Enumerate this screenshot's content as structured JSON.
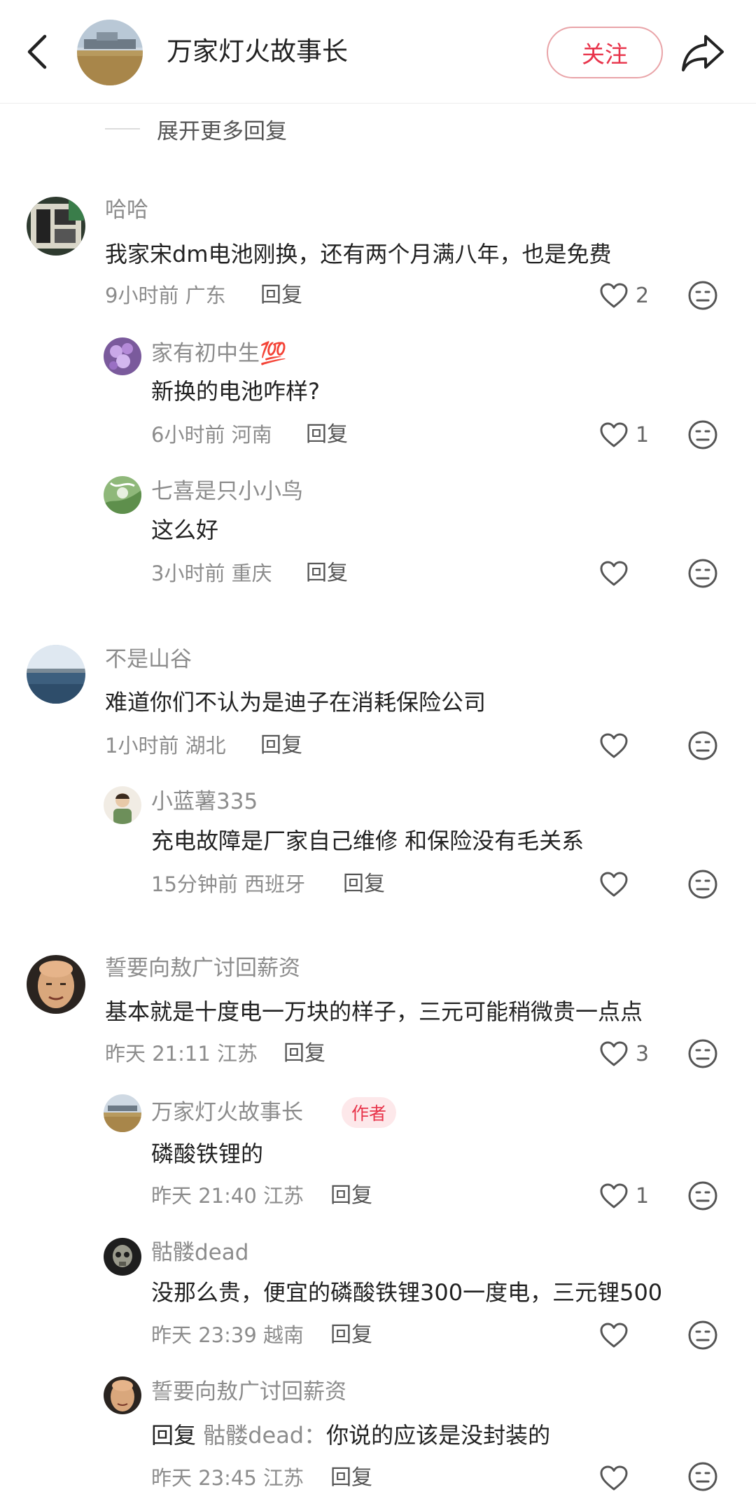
{
  "header": {
    "title": "万家灯火故事长",
    "follow_label": "关注"
  },
  "expand_label": "展开更多回复",
  "reply_label": "回复",
  "author_badge": "作者",
  "comments": [
    {
      "name": "哈哈",
      "text": "我家宋dm电池刚换，还有两个月满八年，也是免费",
      "meta": "9小时前 广东",
      "likes": "2"
    },
    {
      "name": "家有初中生💯",
      "text": "新换的电池咋样?",
      "meta": "6小时前 河南",
      "likes": "1"
    },
    {
      "name": "七喜是只小小鸟",
      "text": "这么好",
      "meta": "3小时前 重庆",
      "likes": ""
    },
    {
      "name": "不是山谷",
      "text": "难道你们不认为是迪子在消耗保险公司",
      "meta": "1小时前 湖北",
      "likes": ""
    },
    {
      "name": "小蓝薯335",
      "text": "充电故障是厂家自己维修 和保险没有毛关系",
      "meta": "15分钟前 西班牙",
      "likes": ""
    },
    {
      "name": "誓要向敖广讨回薪资",
      "text": "基本就是十度电一万块的样子，三元可能稍微贵一点点",
      "meta": "昨天 21:11 江苏",
      "likes": "3"
    },
    {
      "name": "万家灯火故事长",
      "text": "磷酸铁锂的",
      "meta": "昨天 21:40 江苏",
      "likes": "1"
    },
    {
      "name": "骷髅dead",
      "text": "没那么贵，便宜的磷酸铁锂300一度电，三元锂500",
      "meta": "昨天 23:39 越南",
      "likes": ""
    },
    {
      "name": "誓要向敖广讨回薪资",
      "reply_prefix": "回复",
      "reply_to": "骷髅dead：",
      "text": "你说的应该是没封装的",
      "meta": "昨天 23:45 江苏",
      "likes": ""
    }
  ]
}
